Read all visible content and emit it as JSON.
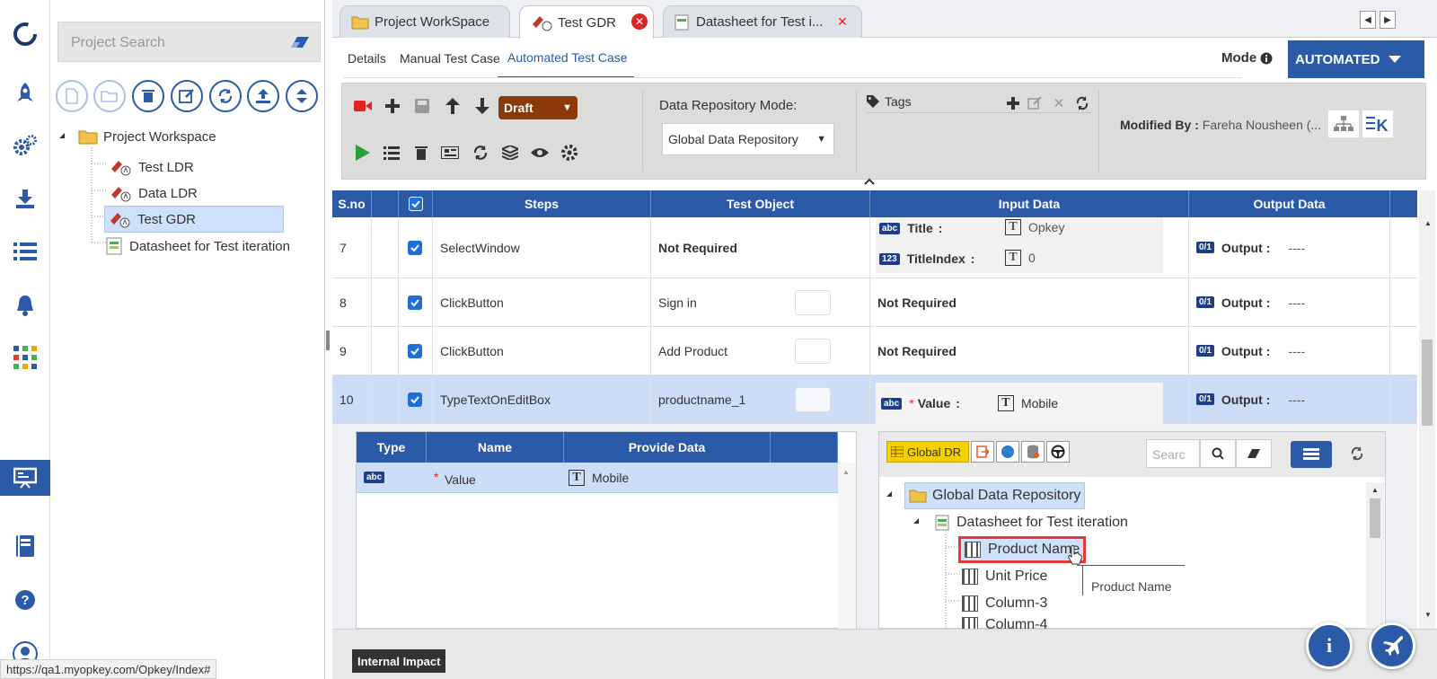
{
  "colors": {
    "accent": "#2a5aa8",
    "danger": "#e02424",
    "draft": "#8a3a0a"
  },
  "rail": {
    "icons": [
      "app-logo-icon",
      "rocket-icon",
      "gears-icon",
      "download-icon",
      "list-icon",
      "bell-icon",
      "apps-grid-icon",
      "presentation-icon",
      "book-icon",
      "help-icon",
      "user-avatar-icon"
    ]
  },
  "explorer": {
    "search_placeholder": "Project Search",
    "tree": {
      "root": "Project Workspace",
      "children": [
        "Test LDR",
        "Data LDR",
        "Test GDR",
        "Datasheet for Test iteration"
      ]
    }
  },
  "tabs": [
    {
      "label": "Project WorkSpace"
    },
    {
      "label": "Test GDR"
    },
    {
      "label": "Datasheet for Test i..."
    }
  ],
  "subtabs": [
    "Details",
    "Manual Test Case",
    "Automated Test Case"
  ],
  "mode": {
    "label": "Mode",
    "value": "AUTOMATED"
  },
  "toolbar": {
    "status": "Draft",
    "dr_mode_label": "Data Repository Mode:",
    "dr_mode_value": "Global Data Repository",
    "tags_label": "Tags",
    "modified_by_label": "Modified By :",
    "modified_by_value": "Fareha Nousheen (..."
  },
  "grid": {
    "headers": [
      "S.no",
      "Steps",
      "Test Object",
      "Input Data",
      "Output Data"
    ],
    "rows": [
      {
        "sno": "7",
        "step": "SelectWindow",
        "object": "Not Required",
        "inputs": [
          {
            "badge": "abc",
            "name": "Title",
            "value": "Opkey"
          },
          {
            "badge": "123",
            "name": "TitleIndex",
            "value": "0"
          }
        ],
        "output": "Output",
        "output_value": "----"
      },
      {
        "sno": "8",
        "step": "ClickButton",
        "object": "Sign in",
        "input_text": "Not Required",
        "output": "Output",
        "output_value": "----"
      },
      {
        "sno": "9",
        "step": "ClickButton",
        "object": "Add Product",
        "input_text": "Not Required",
        "output": "Output",
        "output_value": "----"
      },
      {
        "sno": "10",
        "step": "TypeTextOnEditBox",
        "object": "productname_1",
        "input": {
          "badge": "abc",
          "name": "Value",
          "value": "Mobile"
        },
        "output": "Output",
        "output_value": "----"
      }
    ],
    "output_badge": "0/1"
  },
  "detail": {
    "headers": [
      "Type",
      "Name",
      "Provide Data"
    ],
    "row": {
      "badge": "abc",
      "name": "Value",
      "value": "Mobile"
    },
    "right": {
      "global_dr_button": "Global DR",
      "search_placeholder": "Searc",
      "tree_root": "Global Data Repository",
      "sheet": "Datasheet for Test iteration",
      "columns": [
        "Product Name",
        "Unit Price",
        "Column-3",
        "Column-4"
      ],
      "tooltip": "Product Name"
    }
  },
  "bottom": {
    "internal_impact": "Internal Impact"
  },
  "status_url": "https://qa1.myopkey.com/Opkey/Index#"
}
